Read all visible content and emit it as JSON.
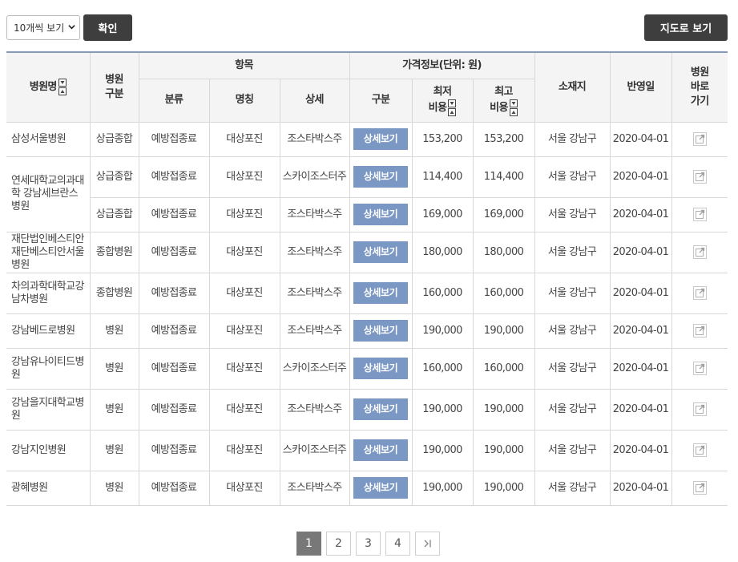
{
  "toolbar": {
    "page_size_select": "10개씩 보기",
    "confirm_label": "확인",
    "map_view_label": "지도로 보기"
  },
  "table": {
    "headers": {
      "hospital_name": "병원명",
      "hospital_type": "병원\n구분",
      "item_group": "항목",
      "category": "분류",
      "name": "명칭",
      "detail": "상세",
      "price_group": "가격정보(단위: 원)",
      "division": "구분",
      "min_cost": "최저\n비용",
      "max_cost": "최고\n비용",
      "location": "소재지",
      "reflected_date": "반영일",
      "shortcut": "병원\n바로\n가기"
    },
    "detail_button_label": "상세보기",
    "hospitals": [
      {
        "name": "삼성서울병원",
        "rows": [
          {
            "type": "상급종합",
            "category": "예방접종료",
            "item": "대상포진",
            "detail": "조스타박스주",
            "min": "153,200",
            "max": "153,200",
            "location": "서울 강남구",
            "date": "2020-04-01"
          }
        ]
      },
      {
        "name": "연세대학교의과대학 강남세브란스병원",
        "rows": [
          {
            "type": "상급종합",
            "category": "예방접종료",
            "item": "대상포진",
            "detail": "스카이조스터주",
            "min": "114,400",
            "max": "114,400",
            "location": "서울 강남구",
            "date": "2020-04-01"
          },
          {
            "type": "상급종합",
            "category": "예방접종료",
            "item": "대상포진",
            "detail": "조스타박스주",
            "min": "169,000",
            "max": "169,000",
            "location": "서울 강남구",
            "date": "2020-04-01"
          }
        ]
      },
      {
        "name": "재단법인베스티안재단베스티안서울병원",
        "rows": [
          {
            "type": "종합병원",
            "category": "예방접종료",
            "item": "대상포진",
            "detail": "조스타박스주",
            "min": "180,000",
            "max": "180,000",
            "location": "서울 강남구",
            "date": "2020-04-01"
          }
        ]
      },
      {
        "name": "차의과학대학교강남차병원",
        "rows": [
          {
            "type": "종합병원",
            "category": "예방접종료",
            "item": "대상포진",
            "detail": "조스타박스주",
            "min": "160,000",
            "max": "160,000",
            "location": "서울 강남구",
            "date": "2020-04-01"
          }
        ]
      },
      {
        "name": "강남베드로병원",
        "rows": [
          {
            "type": "병원",
            "category": "예방접종료",
            "item": "대상포진",
            "detail": "조스타박스주",
            "min": "190,000",
            "max": "190,000",
            "location": "서울 강남구",
            "date": "2020-04-01"
          }
        ]
      },
      {
        "name": "강남유나이티드병원",
        "rows": [
          {
            "type": "병원",
            "category": "예방접종료",
            "item": "대상포진",
            "detail": "스카이조스터주",
            "min": "160,000",
            "max": "160,000",
            "location": "서울 강남구",
            "date": "2020-04-01"
          }
        ]
      },
      {
        "name": "강남을지대학교병원",
        "rows": [
          {
            "type": "병원",
            "category": "예방접종료",
            "item": "대상포진",
            "detail": "조스타박스주",
            "min": "190,000",
            "max": "190,000",
            "location": "서울 강남구",
            "date": "2020-04-01"
          }
        ]
      },
      {
        "name": "강남지인병원",
        "rows": [
          {
            "type": "병원",
            "category": "예방접종료",
            "item": "대상포진",
            "detail": "스카이조스터주",
            "min": "190,000",
            "max": "190,000",
            "location": "서울 강남구",
            "date": "2020-04-01"
          }
        ]
      },
      {
        "name": "광혜병원",
        "rows": [
          {
            "type": "병원",
            "category": "예방접종료",
            "item": "대상포진",
            "detail": "조스타박스주",
            "min": "190,000",
            "max": "190,000",
            "location": "서울 강남구",
            "date": "2020-04-01"
          }
        ]
      }
    ]
  },
  "pagination": {
    "pages": [
      "1",
      "2",
      "3",
      "4"
    ],
    "current": "1",
    "last_icon": "last-page-icon"
  },
  "colors": {
    "dark_button": "#3e3e3e",
    "detail_button": "#7b97c4",
    "header_bg": "#f4f4f4",
    "table_top_border": "#8899b6",
    "active_page": "#787878"
  }
}
